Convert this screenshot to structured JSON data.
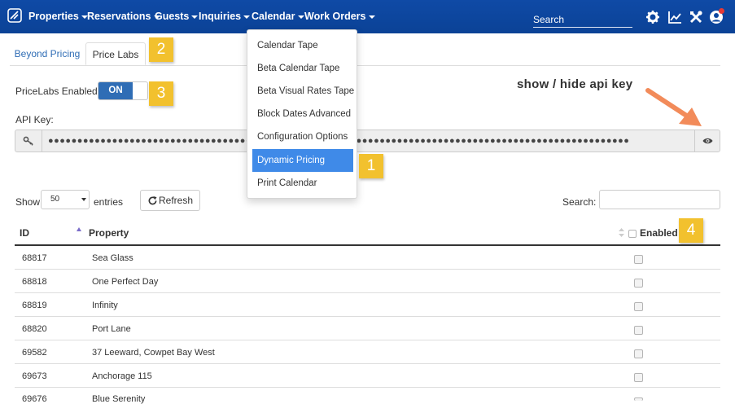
{
  "nav": {
    "items": [
      "Properties",
      "Reservations",
      "Guests",
      "Inquiries",
      "Calendar",
      "Work Orders"
    ],
    "search_placeholder": "Search"
  },
  "tabs": [
    "Beyond Pricing",
    "Price Labs"
  ],
  "pricelabs": {
    "enabled_label": "PriceLabs Enabled:",
    "toggle_state": "ON"
  },
  "api": {
    "label": "API Key:",
    "masked_value": "●●●●●●●●●●●●●●●●●●●●●●●●●●●●●●●●●●●●●●●●●●●●●●●●●●●●●●●●●●●●●●●●●●●●●●●●●●●●●●●●●●●●●●●●●●●●●●●●●●●●"
  },
  "annotation": "show / hide api key",
  "badges": [
    "1",
    "2",
    "3",
    "4"
  ],
  "table_controls": {
    "show_label": "Show",
    "length_value": "50",
    "entries_label": "entries",
    "refresh_label": "Refresh",
    "search_label": "Search:"
  },
  "table": {
    "headers": [
      "ID",
      "Property",
      "Enabled"
    ],
    "rows": [
      {
        "id": "68817",
        "property": "Sea Glass"
      },
      {
        "id": "68818",
        "property": "One Perfect Day"
      },
      {
        "id": "68819",
        "property": "Infinity"
      },
      {
        "id": "68820",
        "property": "Port Lane"
      },
      {
        "id": "69582",
        "property": "37 Leeward, Cowpet Bay West"
      },
      {
        "id": "69673",
        "property": "Anchorage 115"
      },
      {
        "id": "69676",
        "property": "Blue Serenity"
      }
    ]
  },
  "calendar_menu": {
    "items": [
      "Calendar Tape",
      "Beta Calendar Tape",
      "Beta Visual Rates Tape",
      "Block Dates Advanced",
      "Configuration Options",
      "Dynamic Pricing",
      "Print Calendar"
    ],
    "active": "Dynamic Pricing"
  },
  "colors": {
    "navbar": "#0d47a1",
    "accent": "#2f6db5",
    "badge": "#f2c12e",
    "arrow": "#f28b5a",
    "menu_active": "#3f8ae8"
  }
}
